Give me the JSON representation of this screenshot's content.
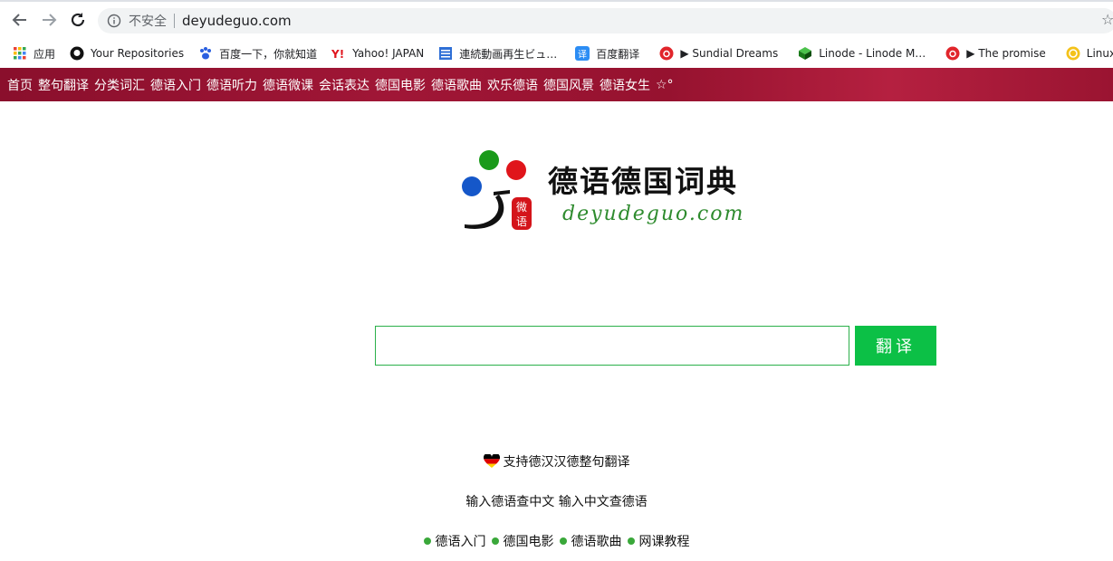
{
  "browser": {
    "insecure_label": "不安全",
    "url": "deyudeguo.com"
  },
  "bookmarks": [
    {
      "label": "应用",
      "icon": "apps-grid-icon"
    },
    {
      "label": "Your Repositories",
      "icon": "github-icon"
    },
    {
      "label": "百度一下，你就知道",
      "icon": "baidu-paw-icon"
    },
    {
      "label": "Yahoo! JAPAN",
      "icon": "yahoo-icon"
    },
    {
      "label": "連続動画再生ビュ…",
      "icon": "doc-list-icon"
    },
    {
      "label": "百度翻译",
      "icon": "translate-icon"
    },
    {
      "label": "▶ Sundial Dreams",
      "icon": "netease-music-icon"
    },
    {
      "label": "Linode - Linode M…",
      "icon": "linode-cube-icon"
    },
    {
      "label": "▶ The promise",
      "icon": "netease-music-icon"
    },
    {
      "label": "Linux Profe",
      "icon": "linux-coin-icon"
    }
  ],
  "nav": [
    "首页",
    "整句翻译",
    "分类词汇",
    "德语入门",
    "德语听力",
    "德语微课",
    "会话表达",
    "德国电影",
    "德语歌曲",
    "欢乐德语",
    "德国风景",
    "德语女生",
    "☆°"
  ],
  "logo": {
    "title": "德语德国词典",
    "subtitle": "deyudeguo.com",
    "seal_top": "微",
    "seal_bottom": "语"
  },
  "search": {
    "placeholder": "",
    "button_label": "翻译"
  },
  "footer": {
    "support_text": "支持德汉汉德整句翻译",
    "hint_text": "输入德语查中文 输入中文查德语",
    "links": [
      "德语入门",
      "德国电影",
      "德语歌曲",
      "网课教程"
    ]
  },
  "colors": {
    "nav_bg": "#9a1431",
    "search_button": "#0cc046",
    "search_border": "#2bb04a",
    "subtitle": "#2e8b2e"
  }
}
